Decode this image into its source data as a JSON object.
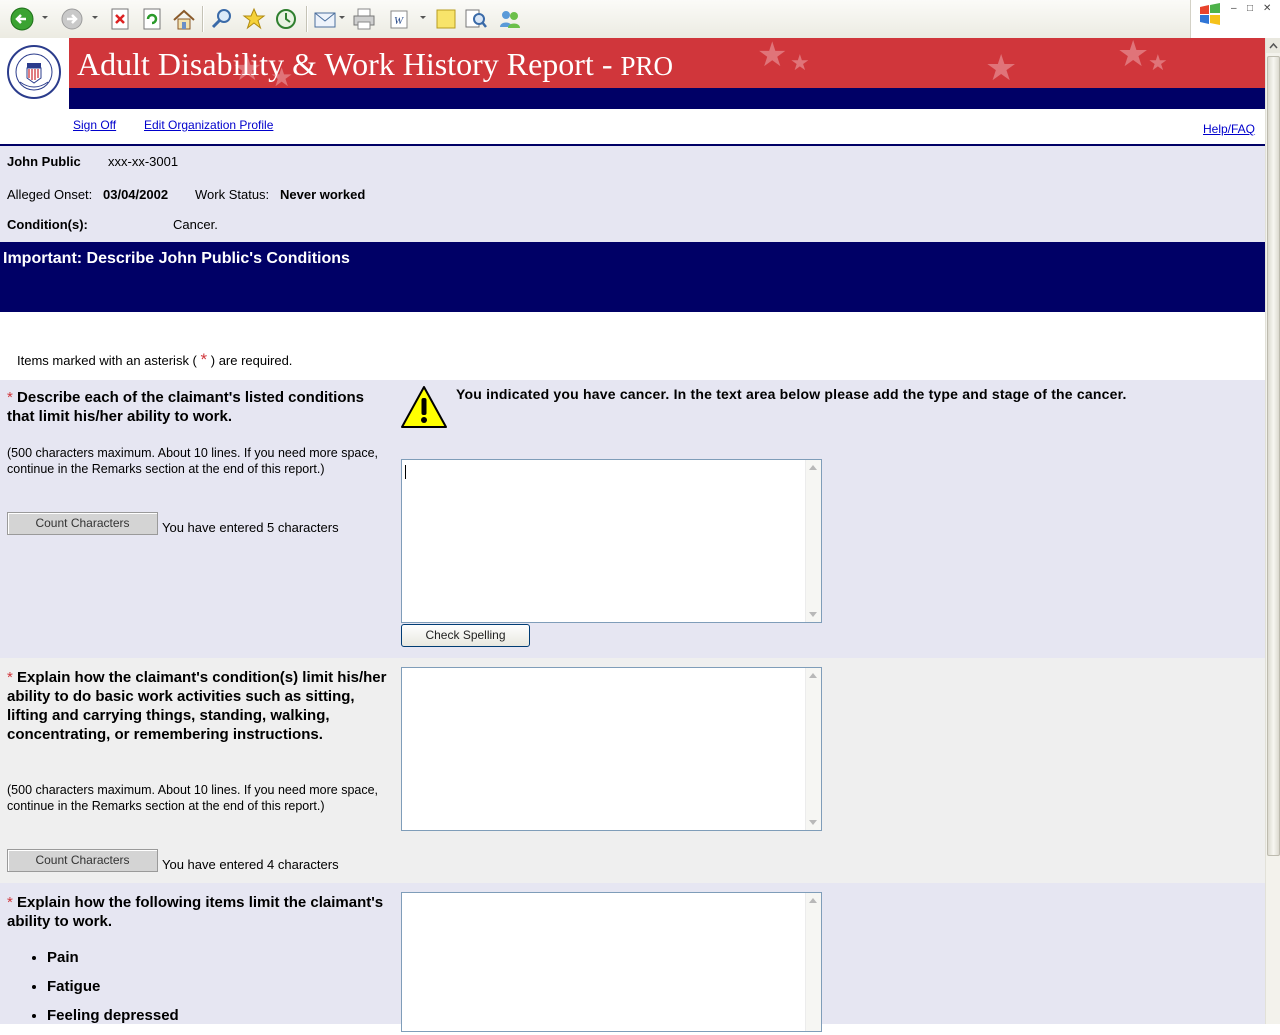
{
  "banner": {
    "title": "Adult Disability & Work History Report - ",
    "title_suffix": "PRO"
  },
  "nav": {
    "sign_off": "Sign Off",
    "edit_profile": "Edit Organization Profile",
    "help": "Help/FAQ"
  },
  "claimant": {
    "name": "John Public",
    "ssn": "xxx-xx-3001",
    "onset_label": "Alleged Onset:",
    "onset_value": "03/04/2002",
    "work_status_label": "Work Status:",
    "work_status_value": "Never worked",
    "conditions_label": "Condition(s):",
    "conditions_value": "Cancer."
  },
  "section": {
    "title": "Important: Describe John Public's Conditions",
    "required_note_pre": "Items marked with an asterisk (",
    "required_note_post": ") are required.",
    "asterisk": "*"
  },
  "q1": {
    "label": "Describe each of the claimant's listed conditions that limit his/her ability to work.",
    "note": "(500 characters maximum. About 10 lines. If you need more space, continue in the Remarks section at the end of this report.)",
    "count_button": "Count Characters",
    "count_text": "You have entered 5 characters",
    "warning": "You indicated you have cancer. In the text area below please add the type and stage of the cancer.",
    "spell_button": "Check Spelling"
  },
  "q2": {
    "label": "Explain how the claimant's condition(s) limit his/her ability to do basic work activities such as sitting, lifting and carrying things, standing, walking, concentrating, or remembering instructions.",
    "note": "(500 characters maximum. About 10 lines. If you need more space, continue in the Remarks section at the end of this report.)",
    "count_button": "Count Characters",
    "count_text": "You have entered 4 characters"
  },
  "q3": {
    "label": "Explain how the following items limit the claimant's ability to work.",
    "items": [
      "Pain",
      "Fatigue",
      "Feeling depressed"
    ]
  },
  "colors": {
    "banner_red": "#d0363b",
    "navy": "#000066",
    "info_bg": "#e6e6f2",
    "link": "#0000cc"
  },
  "icons": [
    "back-icon",
    "forward-icon",
    "stop-icon",
    "refresh-icon",
    "home-icon",
    "search-icon",
    "favorites-icon",
    "history-icon",
    "mail-icon",
    "print-icon",
    "edit-icon",
    "notes-icon",
    "research-icon",
    "messenger-icon",
    "windows-logo-icon",
    "warning-icon"
  ]
}
